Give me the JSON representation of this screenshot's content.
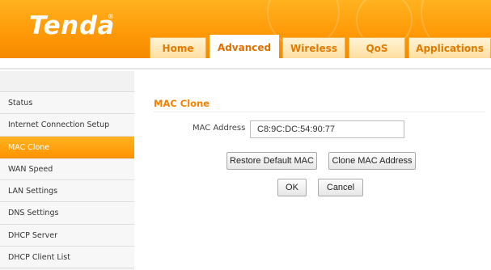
{
  "header": {
    "logo_text": "Tenda",
    "logo_mark": "®",
    "brand_color": "#ff9a08"
  },
  "tabs": [
    {
      "label": "Home",
      "active": false
    },
    {
      "label": "Advanced",
      "active": true
    },
    {
      "label": "Wireless",
      "active": false
    },
    {
      "label": "QoS",
      "active": false
    },
    {
      "label": "Applications",
      "active": false
    }
  ],
  "sidebar": {
    "items": [
      {
        "label": "Status",
        "active": false
      },
      {
        "label": "Internet Connection Setup",
        "active": false
      },
      {
        "label": "MAC Clone",
        "active": true
      },
      {
        "label": "WAN Speed",
        "active": false
      },
      {
        "label": "LAN Settings",
        "active": false
      },
      {
        "label": "DNS Settings",
        "active": false
      },
      {
        "label": "DHCP Server",
        "active": false
      },
      {
        "label": "DHCP Client List",
        "active": false
      }
    ]
  },
  "main": {
    "title": "MAC Clone",
    "mac_label": "MAC Address",
    "mac_value": "C8:9C:DC:54:90:77",
    "restore_label": "Restore Default MAC",
    "clone_label": "Clone MAC Address",
    "ok_label": "OK",
    "cancel_label": "Cancel"
  }
}
